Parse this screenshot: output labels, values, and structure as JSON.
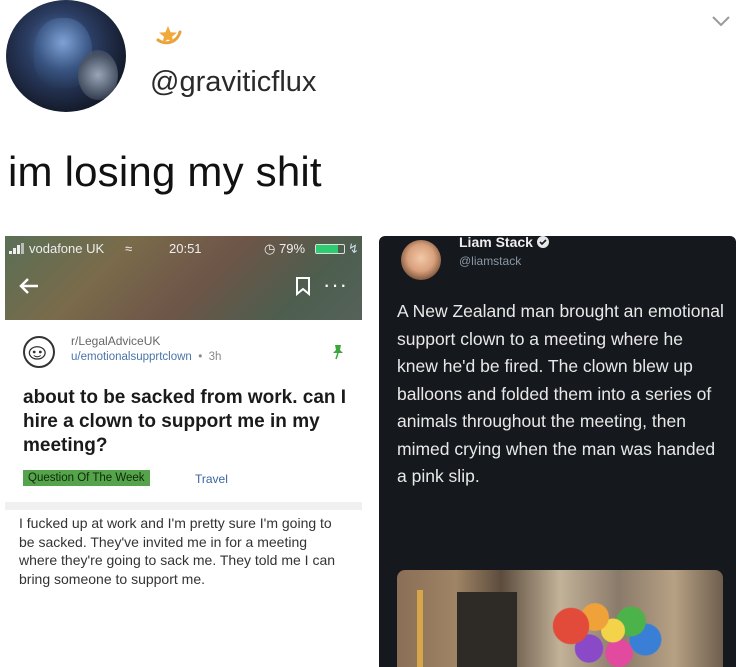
{
  "tweet": {
    "handle": "@graviticflux",
    "text": "im losing my shit"
  },
  "reddit_screenshot": {
    "status_bar": {
      "carrier": "vodafone UK",
      "time": "20:51",
      "battery": "79%",
      "battery_level": 0.79
    },
    "subreddit": "r/LegalAdviceUK",
    "user": "u/emotionalsupprtclown",
    "age": "3h",
    "title": "about to be sacked from work. can I hire a clown to support me in my meeting?",
    "flair_primary": "Question Of The Week",
    "flair_secondary": "Travel",
    "body": "I fucked up at work and I'm pretty sure I'm going to be sacked. They've invited me in for a meeting where they're going to sack me. They told me I can bring someone to support me."
  },
  "twitter_screenshot": {
    "name": "Liam Stack",
    "handle": "@liamstack",
    "text": "A New Zealand man brought an emotional support clown to a meeting where he knew he'd be fired. The clown blew up balloons and folded them into a series of animals throughout the meeting, then mimed crying when the man was handed a pink slip."
  },
  "icons": {
    "badge": "star-badge-icon",
    "chevron": "chevron-down-icon",
    "back": "back-arrow-icon",
    "save": "bookmark-icon",
    "more": "more-icon",
    "pin": "pin-icon",
    "verified": "verified-icon"
  },
  "colors": {
    "background": "#ffffff",
    "flair_green": "#55a34a",
    "link_blue": "#4a74a8",
    "twitter_dark": "#15181c",
    "twitter_handle": "#8899a6"
  }
}
